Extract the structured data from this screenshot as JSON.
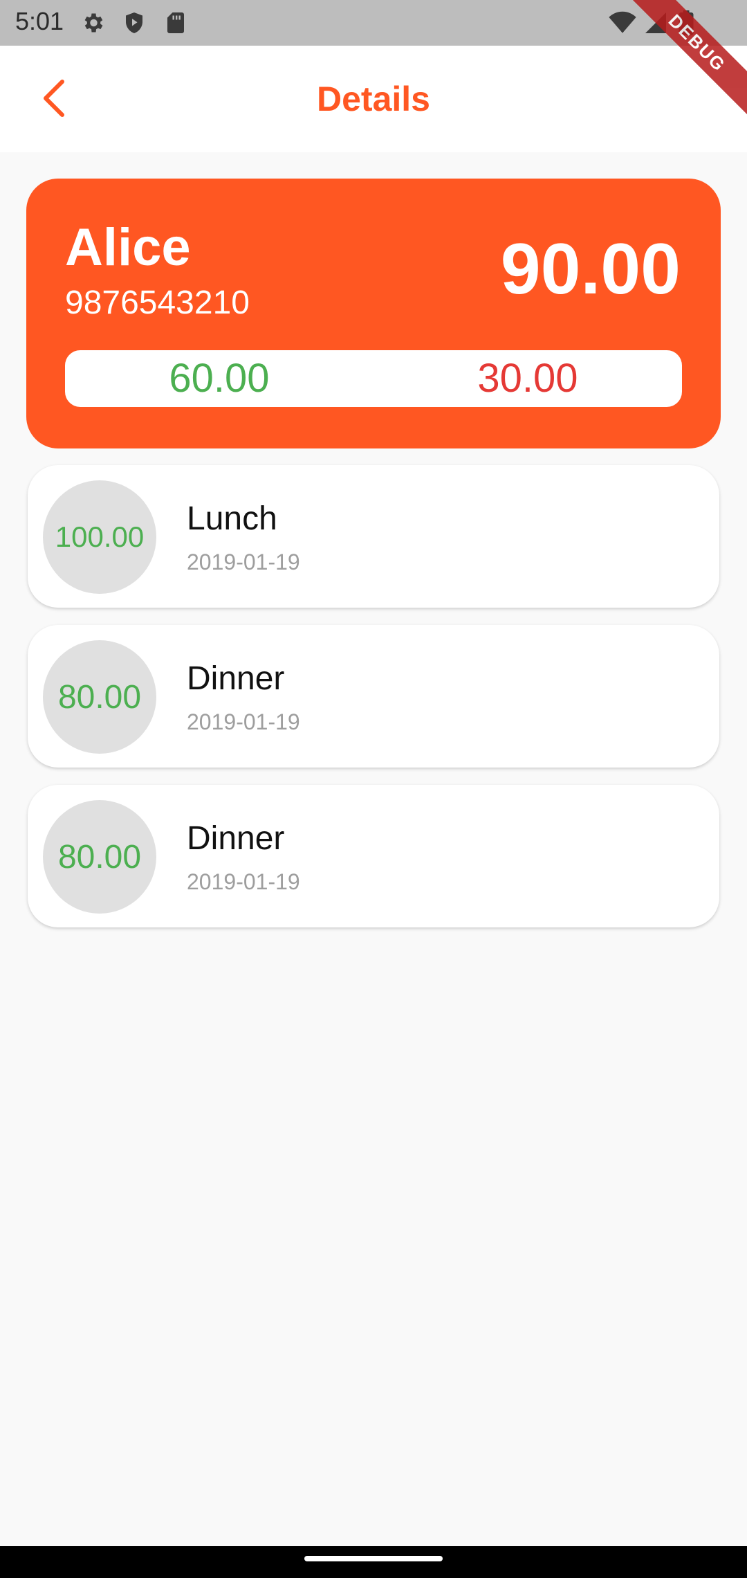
{
  "status_bar": {
    "time": "5:01",
    "debug_label": "DEBUG",
    "icons": [
      "settings-icon",
      "play-protect-icon",
      "sd-card-icon",
      "wifi-icon",
      "signal-icon",
      "battery-icon"
    ]
  },
  "app_bar": {
    "title": "Details",
    "back_icon": "chevron-left-icon"
  },
  "summary": {
    "name": "Alice",
    "phone": "9876543210",
    "balance": "90.00",
    "left_value": "60.00",
    "right_value": "30.00"
  },
  "records": [
    {
      "amount": "100.00",
      "title": "Lunch",
      "date": "2019-01-19"
    },
    {
      "amount": "80.00",
      "title": "Dinner",
      "date": "2019-01-19"
    },
    {
      "amount": "80.00",
      "title": "Dinner",
      "date": "2019-01-19"
    }
  ],
  "colors": {
    "accent": "#ff5722",
    "positive": "#4caf50",
    "negative": "#e53935",
    "background": "#f9f9f9"
  }
}
